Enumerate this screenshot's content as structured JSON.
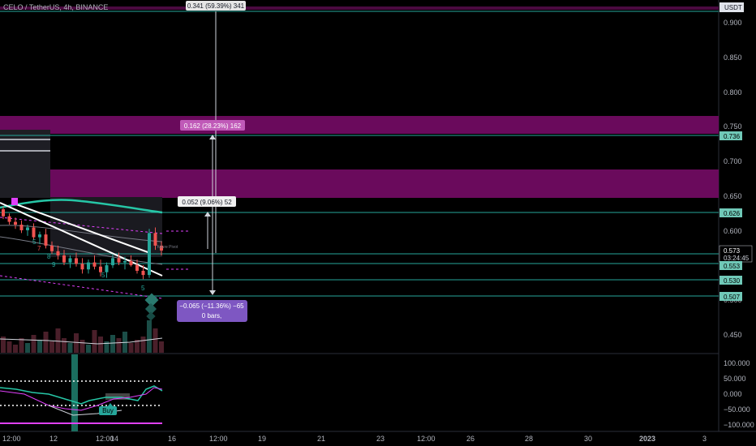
{
  "header": {
    "symbol": "CELO / TetherUS, 4h, BINANCE",
    "currency": "USDT"
  },
  "price_axis": {
    "ticks": [
      "0.900",
      "0.850",
      "0.800",
      "0.750",
      "0.700",
      "0.650",
      "0.600",
      "0.500",
      "0.450"
    ],
    "level_labels": {
      "l736": "0.736",
      "l626": "0.626",
      "l573": "0.573",
      "countdown": "03:24:45",
      "l553": "0.553",
      "l530": "0.530",
      "l507": "0.507"
    }
  },
  "oscillator_axis": {
    "ticks": [
      "100.000",
      "50.000",
      "0.000",
      "−50.000",
      "−100.000"
    ]
  },
  "time_axis": {
    "ticks": [
      "12:00",
      "12",
      "12:00",
      "14",
      "16",
      "12:00",
      "19",
      "21",
      "23",
      "12:00",
      "26",
      "28",
      "30",
      "2023",
      "3"
    ]
  },
  "measurements": {
    "top": "0.341 (59.39%) 341",
    "mid": "0.162 (28.23%) 162",
    "low": "0.052 (9.06%) 52",
    "down_line1": "−0.065 (−11.36%) −65",
    "down_line2": "0 bars,"
  },
  "annotations": {
    "buy": "Buy",
    "nine_label": "9",
    "five_labels": [
      "5",
      "5"
    ],
    "setup_labels": [
      "5",
      "7",
      "8",
      "9"
    ],
    "future_label": "future Pivot"
  },
  "colors": {
    "background": "#000000",
    "bull": "#26a69a",
    "bear": "#ef5350",
    "magenta_zone": "#6a0a5c",
    "teal_line": "#26a69a",
    "level_label_bg": "#70c9b8",
    "measure_purple": "#7e57c2",
    "osc_magenta": "#e040fb"
  },
  "chart_data": {
    "type": "candlestick",
    "symbol": "CELO / TetherUS",
    "interval": "4h",
    "exchange": "BINANCE",
    "y_unit": "USDT",
    "ylim": [
      0.42,
      0.92
    ],
    "price_levels": [
      0.736,
      0.626,
      0.573,
      0.553,
      0.53,
      0.507
    ],
    "candles": [
      {
        "o": 0.632,
        "h": 0.636,
        "l": 0.618,
        "c": 0.622
      },
      {
        "o": 0.622,
        "h": 0.626,
        "l": 0.61,
        "c": 0.614
      },
      {
        "o": 0.614,
        "h": 0.62,
        "l": 0.604,
        "c": 0.61
      },
      {
        "o": 0.61,
        "h": 0.616,
        "l": 0.598,
        "c": 0.602
      },
      {
        "o": 0.602,
        "h": 0.61,
        "l": 0.594,
        "c": 0.606
      },
      {
        "o": 0.606,
        "h": 0.612,
        "l": 0.588,
        "c": 0.592
      },
      {
        "o": 0.592,
        "h": 0.6,
        "l": 0.582,
        "c": 0.596
      },
      {
        "o": 0.596,
        "h": 0.604,
        "l": 0.576,
        "c": 0.58
      },
      {
        "o": 0.58,
        "h": 0.586,
        "l": 0.568,
        "c": 0.572
      },
      {
        "o": 0.572,
        "h": 0.58,
        "l": 0.56,
        "c": 0.566
      },
      {
        "o": 0.566,
        "h": 0.574,
        "l": 0.552,
        "c": 0.556
      },
      {
        "o": 0.556,
        "h": 0.566,
        "l": 0.548,
        "c": 0.562
      },
      {
        "o": 0.562,
        "h": 0.57,
        "l": 0.55,
        "c": 0.554
      },
      {
        "o": 0.554,
        "h": 0.562,
        "l": 0.54,
        "c": 0.546
      },
      {
        "o": 0.546,
        "h": 0.56,
        "l": 0.54,
        "c": 0.556
      },
      {
        "o": 0.556,
        "h": 0.566,
        "l": 0.546,
        "c": 0.55
      },
      {
        "o": 0.55,
        "h": 0.56,
        "l": 0.536,
        "c": 0.542
      },
      {
        "o": 0.542,
        "h": 0.556,
        "l": 0.534,
        "c": 0.552
      },
      {
        "o": 0.552,
        "h": 0.568,
        "l": 0.548,
        "c": 0.562
      },
      {
        "o": 0.562,
        "h": 0.57,
        "l": 0.552,
        "c": 0.556
      },
      {
        "o": 0.556,
        "h": 0.564,
        "l": 0.546,
        "c": 0.558
      },
      {
        "o": 0.558,
        "h": 0.566,
        "l": 0.55,
        "c": 0.552
      },
      {
        "o": 0.552,
        "h": 0.56,
        "l": 0.54,
        "c": 0.544
      },
      {
        "o": 0.544,
        "h": 0.552,
        "l": 0.532,
        "c": 0.538
      },
      {
        "o": 0.538,
        "h": 0.604,
        "l": 0.534,
        "c": 0.598
      },
      {
        "o": 0.598,
        "h": 0.606,
        "l": 0.574,
        "c": 0.58
      },
      {
        "o": 0.58,
        "h": 0.586,
        "l": 0.566,
        "c": 0.573
      }
    ],
    "oscillator": {
      "ylim": [
        -110,
        110
      ],
      "ticks": [
        100,
        50,
        0,
        -50,
        -100
      ]
    }
  }
}
